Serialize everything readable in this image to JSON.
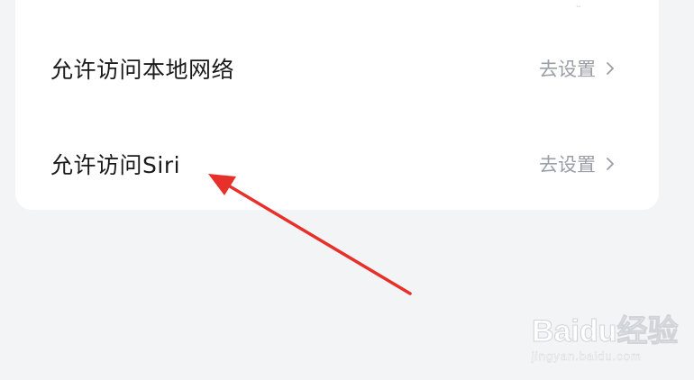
{
  "settings": {
    "rows": [
      {
        "label": "允许访问本地网络",
        "action": "去设置"
      },
      {
        "label": "允许访问Siri",
        "action": "去设置"
      }
    ]
  },
  "annotation": {
    "arrow_color": "#e8302a"
  },
  "watermark": {
    "logo_text": "Baidu经验",
    "url": "jingyan.baidu.com"
  },
  "colors": {
    "background": "#f3f4f6",
    "card": "#ffffff",
    "label": "#1a1a1a",
    "action": "#9a9ea6"
  }
}
